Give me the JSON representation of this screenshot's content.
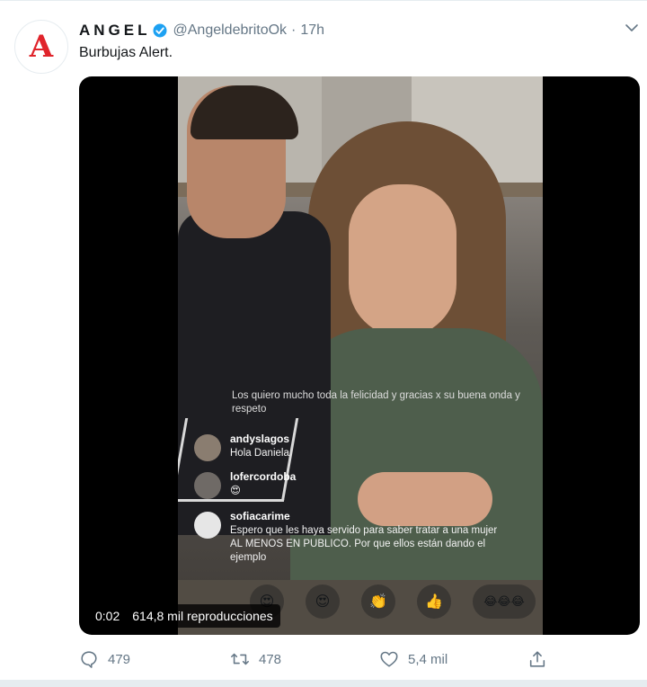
{
  "tweet": {
    "avatar_letter": "A",
    "display_name": "ANGEL",
    "handle": "@AngeldebritoOk",
    "separator": "·",
    "time": "17h",
    "text": "Burbujas Alert."
  },
  "video": {
    "elapsed": "0:02",
    "views": "614,8 mil reproducciones",
    "live_comments": [
      {
        "username": "",
        "text": "Los quiero mucho toda la felicidad y gracias x su buena onda y respeto"
      },
      {
        "username": "andyslagos",
        "text": "Hola Daniela"
      },
      {
        "username": "lofercordoba",
        "text": "😍"
      },
      {
        "username": "sofiacarime",
        "text": "Espero que les haya servido para saber tratar a una mujer AL MENOS EN PUBLICO. Por que ellos están dando el ejemplo"
      }
    ],
    "reactions": [
      "😍",
      "😍",
      "👏",
      "👍",
      "😂😂😂"
    ]
  },
  "actions": {
    "reply_count": "479",
    "retweet_count": "478",
    "like_count": "5,4 mil"
  },
  "colors": {
    "text_primary": "#14171a",
    "text_secondary": "#657786",
    "verified_blue": "#1da1f2",
    "brand_red": "#e0242b"
  }
}
